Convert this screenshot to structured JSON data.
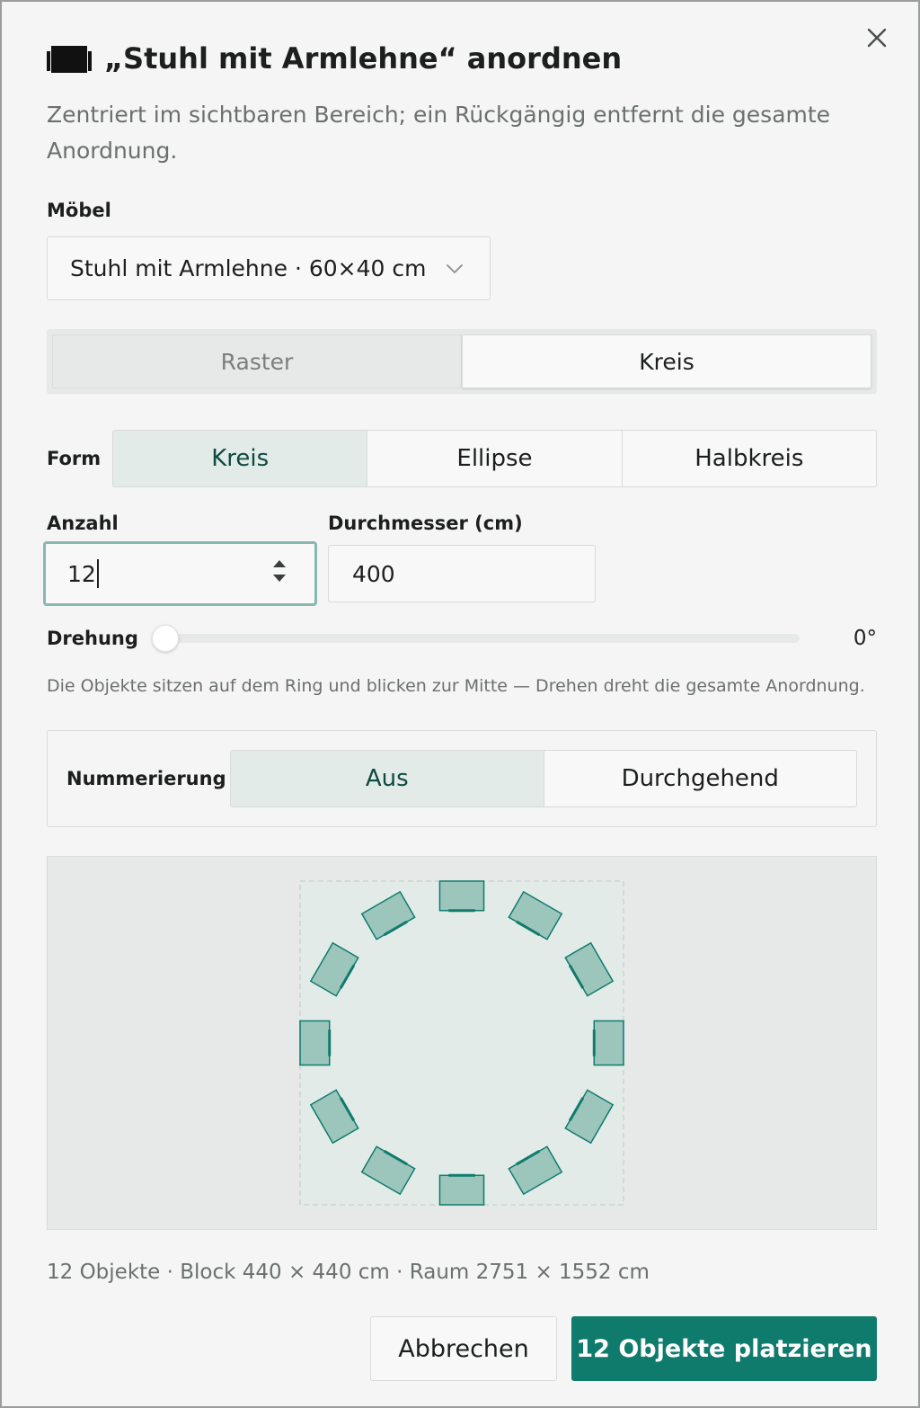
{
  "dialog": {
    "title": "„Stuhl mit Armlehne“ anordnen",
    "subtitle": "Zentriert im sichtbaren Bereich; ein Rückgängig entfernt die gesamte Anordnung.",
    "title_icon": "sofa-icon",
    "close_icon": "close-icon"
  },
  "furniture": {
    "label": "Möbel",
    "selected": "Stuhl mit Armlehne · 60×40 cm"
  },
  "mode": {
    "options": [
      "Raster",
      "Kreis"
    ],
    "selected": "Kreis"
  },
  "shape": {
    "label": "Form",
    "options": [
      "Kreis",
      "Ellipse",
      "Halbkreis"
    ],
    "selected": "Kreis"
  },
  "count": {
    "label": "Anzahl",
    "value": "12"
  },
  "diameter": {
    "label": "Durchmesser (cm)",
    "value": "400"
  },
  "rotation": {
    "label": "Drehung",
    "value_text": "0°",
    "value": 0
  },
  "hint": "Die Objekte sitzen auf dem Ring und blicken zur Mitte — Drehen dreht die gesamte Anordnung.",
  "numbering": {
    "label": "Nummerierung",
    "options": [
      "Aus",
      "Durchgehend"
    ],
    "selected": "Aus"
  },
  "preview": {
    "count": 12,
    "diameter_cm": 400,
    "block_cm": 440,
    "chair_w_cm": 60,
    "chair_d_cm": 40,
    "fill": "#9cc5bc",
    "stroke": "#0f7b6d"
  },
  "footer": {
    "info": "12 Objekte · Block 440 × 440 cm · Raum 2751 × 1552 cm",
    "cancel": "Abbrechen",
    "submit": "12 Objekte platzieren"
  },
  "colors": {
    "accent": "#0f7b6d",
    "segment_active": "#e2ebe8",
    "focus_ring": "#87b9b1"
  }
}
